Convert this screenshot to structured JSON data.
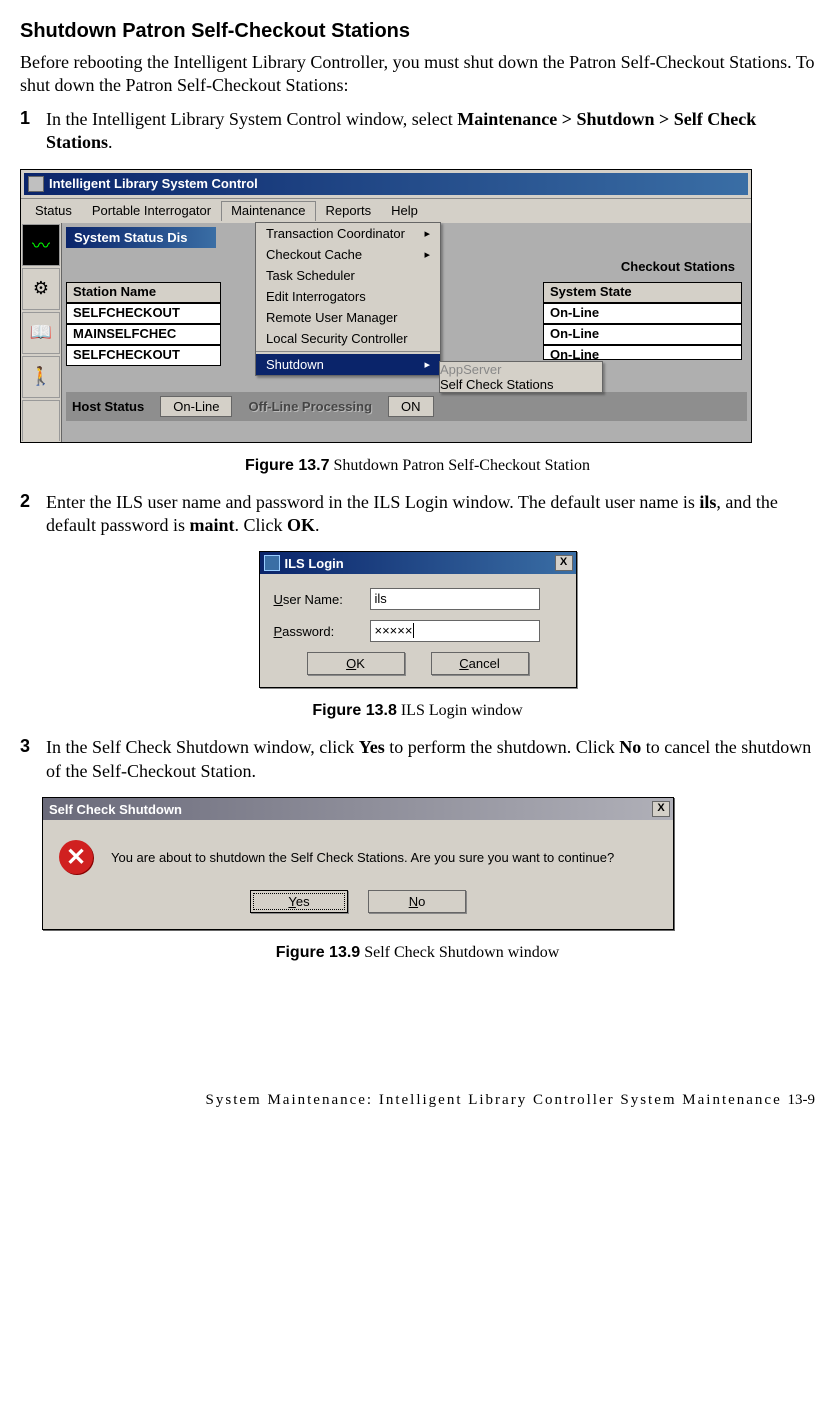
{
  "section_title": "Shutdown Patron Self-Checkout Stations",
  "intro": "Before rebooting the Intelligent Library Controller, you must shut down the Patron Self-Checkout Stations. To shut down the Patron Self-Checkout Stations:",
  "steps": [
    {
      "num": "1",
      "pre": "In the Intelligent Library System Control window, select ",
      "bold": "Maintenance > Shutdown > Self Check Stations",
      "post": "."
    },
    {
      "num": "2",
      "html_parts": {
        "t1": "Enter the ILS user name and password in the ILS Login window. The default user name is ",
        "b1": "ils",
        "t2": ", and the default password is ",
        "b2": "maint",
        "t3": ". Click ",
        "b3": "OK",
        "t4": "."
      }
    },
    {
      "num": "3",
      "html_parts": {
        "t1": "In the Self Check Shutdown window, click ",
        "b1": "Yes",
        "t2": " to perform the shutdown. Click ",
        "b2": "No",
        "t3": " to cancel the shutdown of the Self-Checkout Station."
      }
    }
  ],
  "fig7": {
    "caption_bold": "Figure 13.7",
    "caption_rest": " Shutdown Patron Self-Checkout Station",
    "title": "Intelligent Library System Control",
    "menubar": [
      "Status",
      "Portable Interrogator",
      "Maintenance",
      "Reports",
      "Help"
    ],
    "panel_title": "System Status Dis",
    "checkout_label": "Checkout Stations",
    "col_headers": {
      "station": "Station Name",
      "state": "System State"
    },
    "rows": [
      {
        "station": "SELFCHECKOUT",
        "state": "On-Line"
      },
      {
        "station": "MAINSELFCHEC",
        "state": "On-Line"
      },
      {
        "station": "SELFCHECKOUT",
        "state": "On-Line"
      }
    ],
    "dropdown": [
      {
        "label": "Transaction Coordinator",
        "arrow": true
      },
      {
        "label": "Checkout Cache",
        "arrow": true
      },
      {
        "label": "Task Scheduler"
      },
      {
        "label": "Edit Interrogators"
      },
      {
        "label": "Remote User Manager"
      },
      {
        "label": "Local Security Controller"
      },
      {
        "sep": true
      },
      {
        "label": "Shutdown",
        "arrow": true,
        "highlight": true
      }
    ],
    "submenu": [
      {
        "label": "AppServer",
        "disabled": true
      },
      {
        "label": "Self Check Stations"
      }
    ],
    "status": {
      "host_label": "Host Status",
      "host_value": "On-Line",
      "offline_label": "Off-Line Processing",
      "offline_value": "ON"
    },
    "tool_icons": [
      "chart-icon",
      "tools-icon",
      "book-icon",
      "person-icon"
    ]
  },
  "fig8": {
    "caption_bold": "Figure 13.8",
    "caption_rest": " ILS Login window",
    "title": "ILS Login",
    "close": "X",
    "user_label_pre": "U",
    "user_label_post": "ser Name:",
    "pass_label_pre": "P",
    "pass_label_post": "assword:",
    "user_value": "ils",
    "pass_value": "×××××",
    "ok_pre": "O",
    "ok_post": "K",
    "cancel_pre": "C",
    "cancel_post": "ancel"
  },
  "fig9": {
    "caption_bold": "Figure 13.9",
    "caption_rest": " Self Check Shutdown window",
    "title": "Self Check Shutdown",
    "close": "X",
    "message": "You are about to shutdown the Self Check Stations. Are you sure you want to continue?",
    "yes_pre": "Y",
    "yes_post": "es",
    "no_pre": "N",
    "no_post": "o",
    "err_glyph": "✕"
  },
  "footer": {
    "text": "System Maintenance: Intelligent Library Controller System Maintenance",
    "page": "13-9"
  }
}
